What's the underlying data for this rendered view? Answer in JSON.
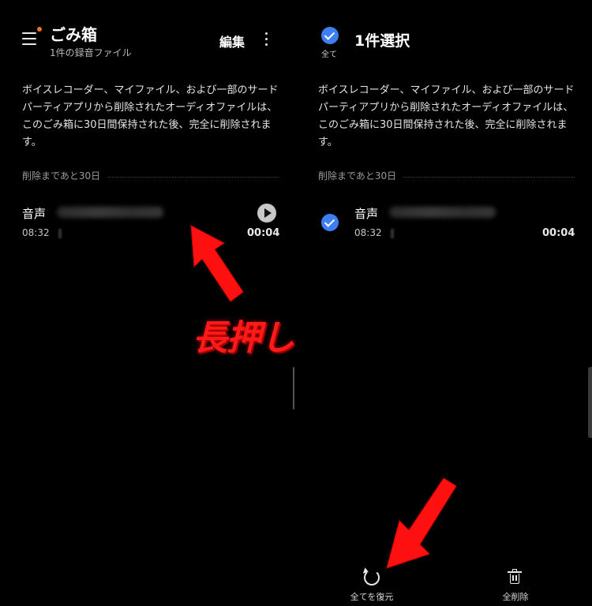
{
  "left_panel": {
    "title": "ごみ箱",
    "subtitle": "1件の録音ファイル",
    "edit_label": "編集",
    "description": "ボイスレコーダー、マイファイル、および一部のサードパーティアプリから削除されたオーディオファイルは、このごみ箱に30日間保持された後、完全に削除されます。",
    "section_label": "削除まであと30日",
    "item": {
      "name": "音声",
      "time": "08:32",
      "duration": "00:04"
    }
  },
  "right_panel": {
    "select_all_label": "全て",
    "selected_count": "1件選択",
    "description": "ボイスレコーダー、マイファイル、および一部のサードパーティアプリから削除されたオーディオファイルは、このごみ箱に30日間保持された後、完全に削除されます。",
    "section_label": "削除まであと30日",
    "item": {
      "name": "音声",
      "time": "08:32",
      "duration": "00:04"
    },
    "bottom_bar": {
      "restore_all_label": "全てを復元",
      "delete_all_label": "全削除"
    }
  },
  "annotation": {
    "long_press_label": "長押し"
  },
  "colors": {
    "background": "#000000",
    "accent_check": "#3d7ef2",
    "notification_dot": "#e8742c",
    "annotation_red": "#ff1a1a"
  },
  "icons": [
    "menu-icon",
    "more-vert-icon",
    "play-icon",
    "check-circle-icon",
    "restore-icon",
    "trash-icon"
  ]
}
